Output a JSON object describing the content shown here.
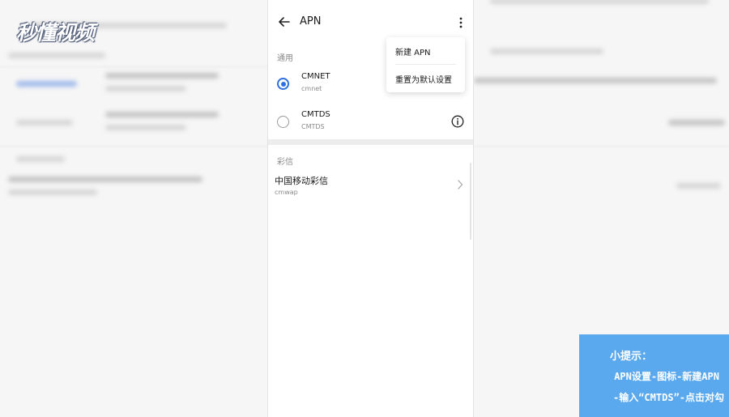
{
  "logo": {
    "text": "秒懂视频"
  },
  "app_bar": {
    "title": "APN",
    "back_icon": "arrow-left-icon",
    "more_icon": "more-vertical-icon"
  },
  "sections": {
    "general": {
      "label": "通用",
      "items": [
        {
          "name": "CMNET",
          "apn": "cmnet",
          "selected": true
        },
        {
          "name": "CMTDS",
          "apn": "CMTDS",
          "selected": false,
          "info_icon": "info-icon"
        }
      ]
    },
    "mms": {
      "label": "彩信",
      "items": [
        {
          "name": "中国移动彩信",
          "apn": "cmwap",
          "chevron_icon": "chevron-right-icon"
        }
      ]
    }
  },
  "menu": {
    "items": [
      "新建 APN",
      "重置为默认设置"
    ]
  },
  "tip": {
    "heading": "小提示：",
    "line1": "APN设置-图标-新建APN",
    "line2": "-输入“CMTDS”-点击对勾"
  },
  "colors": {
    "accent": "#2f6fe4",
    "tip_background": "#5aa9ee"
  }
}
